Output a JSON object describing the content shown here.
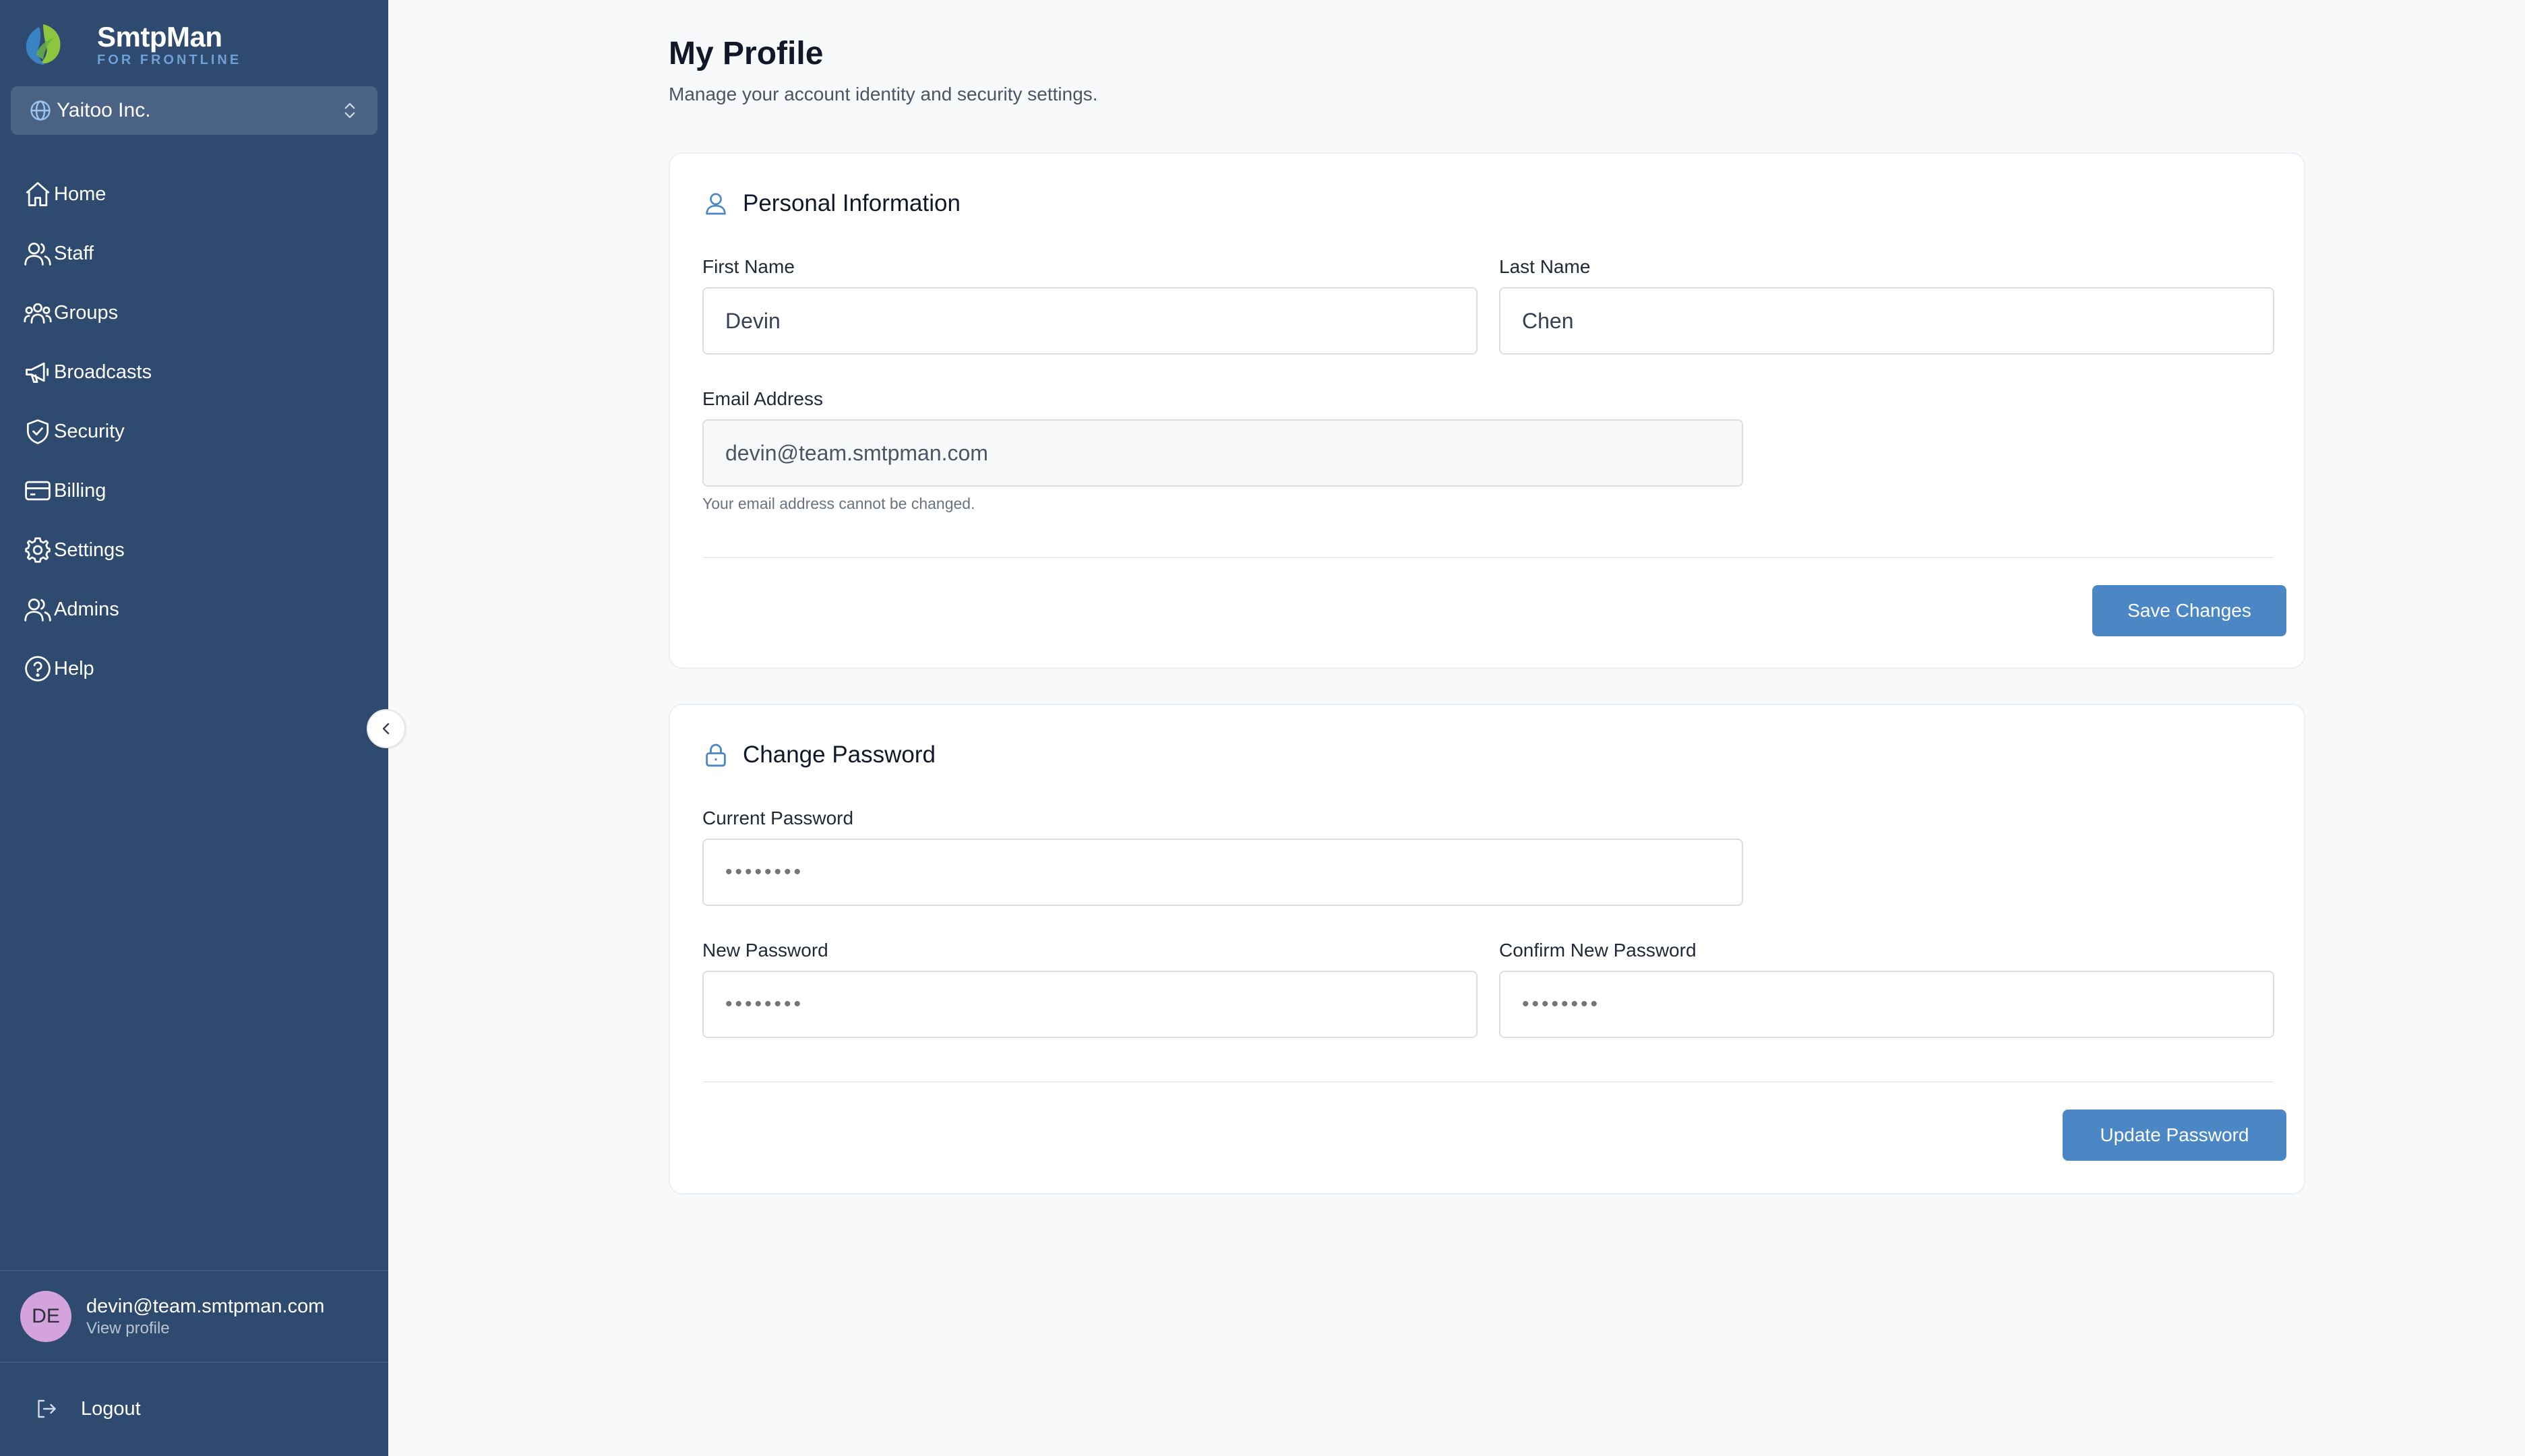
{
  "brand": {
    "name": "SmtpMan",
    "tagline": "FOR FRONTLINE"
  },
  "org_selector": {
    "value": "Yaitoo Inc.",
    "icon": "globe-icon"
  },
  "sidebar": {
    "items": [
      {
        "label": "Home",
        "icon": "home-icon"
      },
      {
        "label": "Staff",
        "icon": "users-icon"
      },
      {
        "label": "Groups",
        "icon": "groups-icon"
      },
      {
        "label": "Broadcasts",
        "icon": "megaphone-icon"
      },
      {
        "label": "Security",
        "icon": "shield-check-icon"
      },
      {
        "label": "Billing",
        "icon": "credit-card-icon"
      },
      {
        "label": "Settings",
        "icon": "gear-icon"
      },
      {
        "label": "Admins",
        "icon": "users-icon"
      },
      {
        "label": "Help",
        "icon": "help-circle-icon"
      }
    ]
  },
  "user": {
    "initials": "DE",
    "email": "devin@team.smtpman.com",
    "view_profile": "View profile"
  },
  "logout": {
    "label": "Logout"
  },
  "page": {
    "title": "My Profile",
    "subtitle": "Manage your account identity and security settings."
  },
  "personal_info": {
    "title": "Personal Information",
    "first_name_label": "First Name",
    "first_name_value": "Devin",
    "last_name_label": "Last Name",
    "last_name_value": "Chen",
    "email_label": "Email Address",
    "email_value": "devin@team.smtpman.com",
    "email_hint": "Your email address cannot be changed.",
    "save_label": "Save Changes"
  },
  "change_password": {
    "title": "Change Password",
    "current_label": "Current Password",
    "current_placeholder": "••••••••",
    "new_label": "New Password",
    "new_placeholder": "••••••••",
    "confirm_label": "Confirm New Password",
    "confirm_placeholder": "••••••••",
    "update_label": "Update Password"
  },
  "colors": {
    "sidebar_bg": "#2e4a6f",
    "accent": "#4a87c4",
    "avatar_bg": "#d4a2dc"
  }
}
